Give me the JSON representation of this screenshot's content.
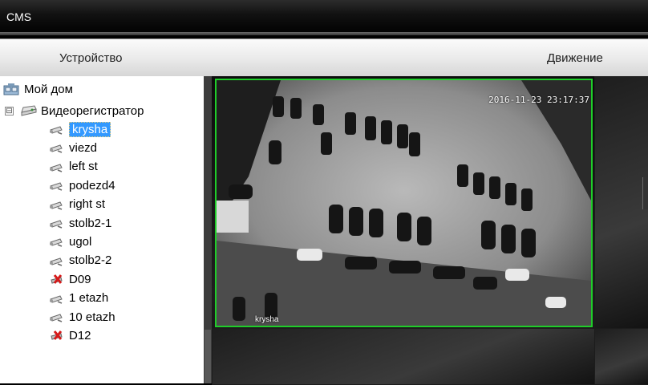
{
  "window": {
    "title": "CMS"
  },
  "menu": {
    "tabs": [
      {
        "label": "Устройство"
      },
      {
        "label": "Движение"
      }
    ]
  },
  "tree": {
    "root": {
      "label": "Мой дом",
      "icon": "home-icon"
    },
    "device": {
      "label": "Видеорегистратор",
      "expander": "⊟",
      "icon": "dvr-icon"
    },
    "channels": [
      {
        "label": "krysha",
        "status": "online",
        "selected": true
      },
      {
        "label": "viezd",
        "status": "online"
      },
      {
        "label": "left st",
        "status": "online"
      },
      {
        "label": "podezd4",
        "status": "online"
      },
      {
        "label": "right st",
        "status": "online"
      },
      {
        "label": "stolb2-1",
        "status": "online"
      },
      {
        "label": "ugol",
        "status": "online"
      },
      {
        "label": "stolb2-2",
        "status": "online"
      },
      {
        "label": "D09",
        "status": "offline"
      },
      {
        "label": "1 etazh",
        "status": "online"
      },
      {
        "label": "10 etazh",
        "status": "online"
      },
      {
        "label": "D12",
        "status": "offline"
      }
    ]
  },
  "video": {
    "timestamp": "2016-11-23 23:17:37",
    "camera_label": "krysha",
    "active_border_color": "#1fcd29"
  },
  "colors": {
    "selection": "#3399ff",
    "offline": "#d61a1a"
  }
}
